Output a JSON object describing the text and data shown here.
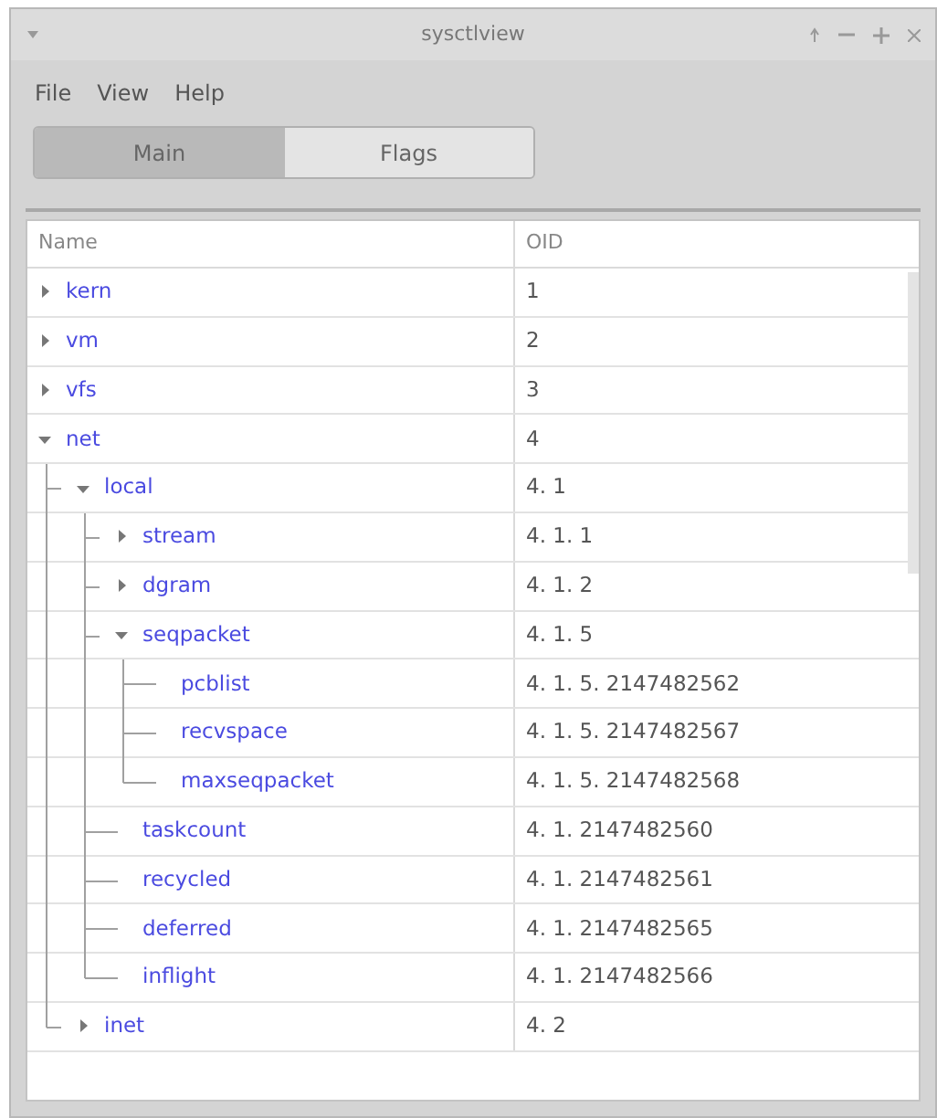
{
  "window": {
    "title": "sysctlview"
  },
  "menu": [
    "File",
    "View",
    "Help"
  ],
  "tabs": [
    {
      "label": "Main",
      "selected": true
    },
    {
      "label": "Flags",
      "selected": false
    }
  ],
  "table": {
    "columns": [
      "Name",
      "OID"
    ],
    "rows": [
      {
        "name": "kern",
        "oid": "1",
        "kind": "branch",
        "expanded": false
      },
      {
        "name": "vm",
        "oid": "2",
        "kind": "branch",
        "expanded": false
      },
      {
        "name": "vfs",
        "oid": "3",
        "kind": "branch",
        "expanded": false
      },
      {
        "name": "net",
        "oid": "4",
        "kind": "branch",
        "expanded": true,
        "children": [
          {
            "name": "local",
            "oid": "4. 1",
            "kind": "branch",
            "expanded": true,
            "children": [
              {
                "name": "stream",
                "oid": "4. 1. 1",
                "kind": "branch",
                "expanded": false
              },
              {
                "name": "dgram",
                "oid": "4. 1. 2",
                "kind": "branch",
                "expanded": false
              },
              {
                "name": "seqpacket",
                "oid": "4. 1. 5",
                "kind": "branch",
                "expanded": true,
                "children": [
                  {
                    "name": "pcblist",
                    "oid": "4. 1. 5. 2147482562",
                    "kind": "leaf"
                  },
                  {
                    "name": "recvspace",
                    "oid": "4. 1. 5. 2147482567",
                    "kind": "leaf"
                  },
                  {
                    "name": "maxseqpacket",
                    "oid": "4. 1. 5. 2147482568",
                    "kind": "leaf"
                  }
                ]
              },
              {
                "name": "taskcount",
                "oid": "4. 1. 2147482560",
                "kind": "leaf"
              },
              {
                "name": "recycled",
                "oid": "4. 1. 2147482561",
                "kind": "leaf"
              },
              {
                "name": "deferred",
                "oid": "4. 1. 2147482565",
                "kind": "leaf"
              },
              {
                "name": "inflight",
                "oid": "4. 1. 2147482566",
                "kind": "leaf"
              }
            ]
          },
          {
            "name": "inet",
            "oid": "4. 2",
            "kind": "branch",
            "expanded": false
          }
        ]
      }
    ]
  }
}
